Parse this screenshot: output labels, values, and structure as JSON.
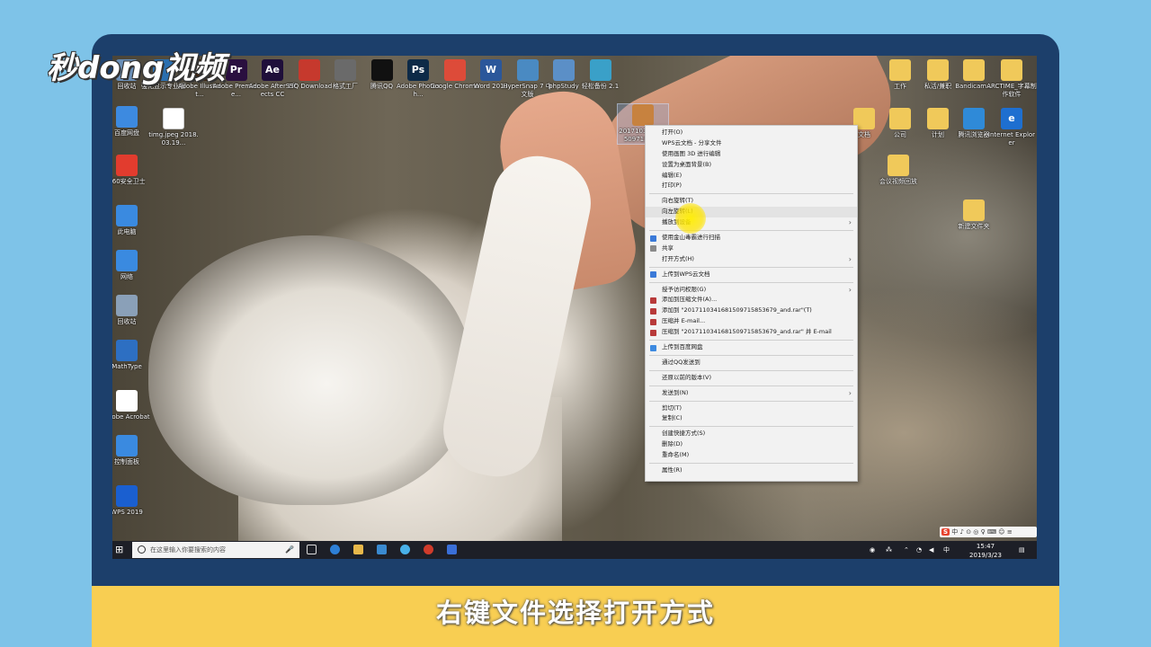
{
  "logo": "秒dong视频",
  "caption": "右键文件选择打开方式",
  "desktop": {
    "top_icons": [
      {
        "label": "回收站",
        "color": "#6a8fb8",
        "icon": "recycle-bin-icon"
      },
      {
        "label": "强化显示专业版",
        "color": "#2a6fb0",
        "icon": "app-icon"
      },
      {
        "label": "Adobe Illustrat...",
        "color": "#3d2412",
        "icon": "illustrator-icon",
        "glyph": "Ai"
      },
      {
        "label": "Adobe Premiere...",
        "color": "#2a0f3f",
        "icon": "premiere-icon",
        "glyph": "Pr"
      },
      {
        "label": "Adobe After Effects CC",
        "color": "#1f0f3a",
        "icon": "after-effects-icon",
        "glyph": "Ae"
      },
      {
        "label": "SSQ Download",
        "color": "#c6392d",
        "icon": "download-icon"
      },
      {
        "label": "格式工厂",
        "color": "#6a6a6a",
        "icon": "format-factory-icon"
      },
      {
        "label": "腾讯QQ",
        "color": "#111111",
        "icon": "qq-icon"
      },
      {
        "label": "Adobe Photosh...",
        "color": "#0d2a47",
        "icon": "photoshop-icon",
        "glyph": "Ps"
      },
      {
        "label": "Google Chrome",
        "color": "#dd4b39",
        "icon": "chrome-icon"
      },
      {
        "label": "Word 2013",
        "color": "#2b579a",
        "icon": "word-icon",
        "glyph": "W"
      },
      {
        "label": "HyperSnap 7 中文版",
        "color": "#4a8ac2",
        "icon": "hypersnap-icon"
      },
      {
        "label": "phpStudy",
        "color": "#5b8fc7",
        "icon": "phpstudy-icon"
      },
      {
        "label": "轻松备份 2.1",
        "color": "#3aa0c8",
        "icon": "backup-icon"
      }
    ],
    "right_icons": [
      {
        "label": "工作"
      },
      {
        "label": "私活/兼职"
      },
      {
        "label": "Bandicam..."
      },
      {
        "label": "ARCTIME_字幕制作软件"
      },
      {
        "label": "文档"
      },
      {
        "label": "公司"
      },
      {
        "label": "计划"
      },
      {
        "label": "腾讯浏览器"
      },
      {
        "label": "Internet Explorer"
      },
      {
        "label": "会议视频回放"
      },
      {
        "label": "新建文件夹"
      }
    ],
    "left_icons": [
      {
        "label": "百度网盘",
        "color": "#3d8ae0",
        "icon": "baidu-netdisk-icon"
      },
      {
        "label": "360安全卫士",
        "color": "#e23c2e",
        "icon": "security-icon"
      },
      {
        "label": "此电脑",
        "color": "#3a8ae0",
        "icon": "computer-icon"
      },
      {
        "label": "网络",
        "color": "#3a8ae0",
        "icon": "network-icon"
      },
      {
        "label": "回收站",
        "color": "#8aa0b8",
        "icon": "recycle-bin-icon"
      },
      {
        "label": "MathType",
        "color": "#2d6fc2",
        "icon": "mathtype-icon"
      },
      {
        "label": "Adobe Acrobat",
        "color": "#ffffff",
        "icon": "acrobat-icon"
      },
      {
        "label": "控制面板",
        "color": "#3a8ae0",
        "icon": "control-panel-icon"
      },
      {
        "label": "WPS 2019",
        "color": "#1a5fd0",
        "icon": "wps-icon"
      }
    ],
    "selected_file_label": "20171034168150971585...",
    "second_file_label": "timg.jpeg 2018.03.19..."
  },
  "context_menu": {
    "items": [
      {
        "label": "打开(O)",
        "icon": null,
        "submenu": false
      },
      {
        "label": "WPS云文档 - 分享文件",
        "icon": null,
        "submenu": false
      },
      {
        "label": "使用画图 3D 进行编辑",
        "icon": null,
        "submenu": false
      },
      {
        "label": "设置为桌面背景(B)",
        "icon": null,
        "submenu": false
      },
      {
        "label": "编辑(E)",
        "icon": null,
        "submenu": false
      },
      {
        "label": "打印(P)",
        "icon": null,
        "submenu": false
      },
      {
        "sep": true
      },
      {
        "label": "向右旋转(T)",
        "icon": null,
        "submenu": false
      },
      {
        "label": "向左旋转(L)",
        "icon": null,
        "submenu": false,
        "highlight": true
      },
      {
        "label": "播放到设备",
        "icon": null,
        "submenu": true
      },
      {
        "sep": true
      },
      {
        "label": "使用金山毒霸进行扫描",
        "icon": "#3b7ad8",
        "submenu": false
      },
      {
        "label": "共享",
        "icon": "#8a8a8a",
        "submenu": false
      },
      {
        "label": "打开方式(H)",
        "icon": null,
        "submenu": true
      },
      {
        "sep": true
      },
      {
        "label": "上传到WPS云文档",
        "icon": "#3b7ad8",
        "submenu": false
      },
      {
        "sep": true
      },
      {
        "label": "授予访问权限(G)",
        "icon": null,
        "submenu": true
      },
      {
        "label": "添加到压缩文件(A)...",
        "icon": "#b83a3a",
        "submenu": false
      },
      {
        "label": "添加到 \"20171103416815097158536​79_and.rar\"(T)",
        "icon": "#b83a3a",
        "submenu": false
      },
      {
        "label": "压缩并 E-mail...",
        "icon": "#b83a3a",
        "submenu": false
      },
      {
        "label": "压缩到 \"20171103416815097158536​79_and.rar\" 并 E-mail",
        "icon": "#b83a3a",
        "submenu": false
      },
      {
        "sep": true
      },
      {
        "label": "上传到百度网盘",
        "icon": "#3d8ae0",
        "submenu": false
      },
      {
        "sep": true
      },
      {
        "label": "通过QQ发送到",
        "icon": null,
        "submenu": false
      },
      {
        "sep": true
      },
      {
        "label": "还原以前的版本(V)",
        "icon": null,
        "submenu": false
      },
      {
        "sep": true
      },
      {
        "label": "发送到(N)",
        "icon": null,
        "submenu": true
      },
      {
        "sep": true
      },
      {
        "label": "剪切(T)",
        "icon": null,
        "submenu": false
      },
      {
        "label": "复制(C)",
        "icon": null,
        "submenu": false
      },
      {
        "sep": true
      },
      {
        "label": "创建快捷方式(S)",
        "icon": null,
        "submenu": false
      },
      {
        "label": "删除(D)",
        "icon": null,
        "submenu": false
      },
      {
        "label": "重命名(M)",
        "icon": null,
        "submenu": false
      },
      {
        "sep": true
      },
      {
        "label": "属性(R)",
        "icon": null,
        "submenu": false
      }
    ]
  },
  "taskbar": {
    "search_placeholder": "在这里输入你要搜索的内容",
    "ime_bar": "中 ♪ ⊙ ◎ ♀ ⌨ ☺ ≡",
    "time": "15:47",
    "date": "2019/3/23",
    "tray_lang": "中"
  }
}
